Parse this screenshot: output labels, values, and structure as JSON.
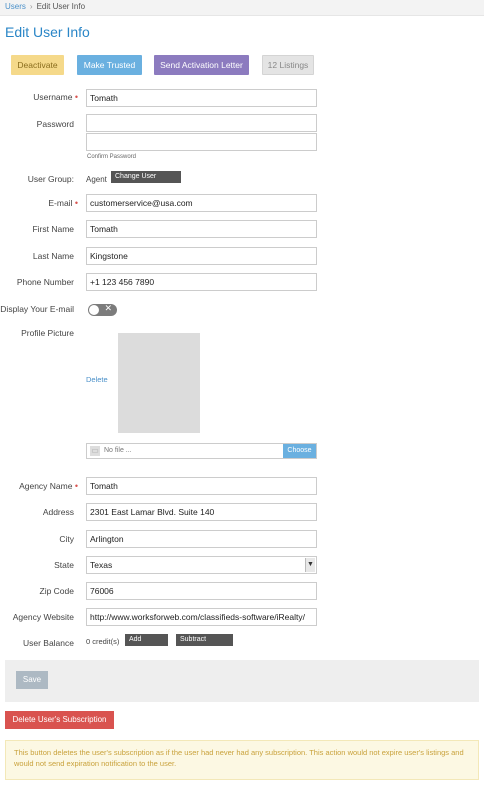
{
  "breadcrumb": {
    "parent": "Users",
    "separator": "›",
    "current": "Edit User Info"
  },
  "page_title": "Edit User Info",
  "actions": {
    "deactivate": "Deactivate",
    "make_trusted": "Make Trusted",
    "send_activation": "Send Activation Letter",
    "listings": "12 Listings"
  },
  "form": {
    "username": {
      "label": "Username",
      "value": "Tomath"
    },
    "password": {
      "label": "Password",
      "value": "",
      "confirm_caption": "Confirm Password"
    },
    "user_group": {
      "label": "User Group:",
      "value": "Agent",
      "button": "Change User Group"
    },
    "email": {
      "label": "E-mail",
      "value": "customerservice@usa.com"
    },
    "first_name": {
      "label": "First Name",
      "value": "Tomath"
    },
    "last_name": {
      "label": "Last Name",
      "value": "Kingstone"
    },
    "phone": {
      "label": "Phone Number",
      "value": "+1 123 456 7890"
    },
    "display_email": {
      "label": "Display Your E-mail",
      "toggle_glyph": "✕",
      "enabled": false
    },
    "profile_picture": {
      "label": "Profile Picture",
      "delete": "Delete",
      "file_placeholder": "No file ...",
      "choose": "Choose"
    },
    "agency_name": {
      "label": "Agency Name",
      "value": "Tomath"
    },
    "address": {
      "label": "Address",
      "value": "2301 East Lamar Blvd. Suite 140"
    },
    "city": {
      "label": "City",
      "value": "Arlington"
    },
    "state": {
      "label": "State",
      "value": "Texas"
    },
    "zip": {
      "label": "Zip Code",
      "value": "76006"
    },
    "website": {
      "label": "Agency Website",
      "value": "http://www.worksforweb.com/classifieds-software/iRealty/"
    },
    "balance": {
      "label": "User Balance",
      "value": "0 credit(s)",
      "add": "Add Credits",
      "subtract": "Subtract Credits"
    }
  },
  "required_marker": "•",
  "save": "Save",
  "delete_subscription": "Delete User's Subscription",
  "warning": "This button deletes the user's subscription as if the user had never had any subscription. This action would not expire user's listings and would not send expiration notification to the user.",
  "icons": {
    "file": "file-icon",
    "dropdown": "dropdown-arrow-icon",
    "photo_alt": "profile-photo"
  },
  "colors": {
    "accent": "#2a86c7",
    "danger": "#d9534f",
    "warning_text": "#c9a23c"
  }
}
